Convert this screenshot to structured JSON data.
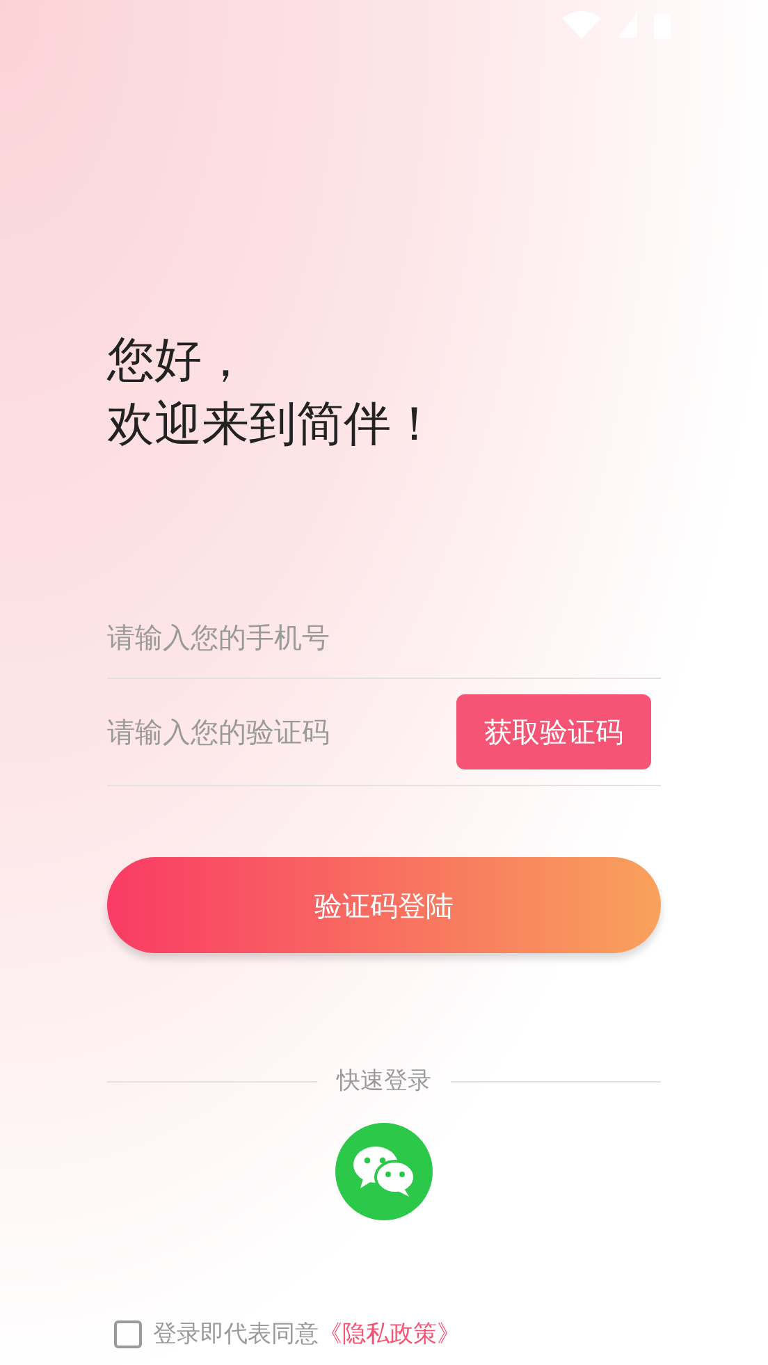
{
  "greeting": [
    "您好，",
    "欢迎来到简伴！"
  ],
  "phone_field": {
    "placeholder": "请输入您的手机号"
  },
  "code_field": {
    "placeholder": "请输入您的验证码"
  },
  "get_code_button": "获取验证码",
  "login_button": "验证码登陆",
  "quick_login": {
    "label": "快速登录"
  },
  "agreement": {
    "checked": false,
    "text": "登录即代表同意",
    "link": "《隐私政策》"
  }
}
